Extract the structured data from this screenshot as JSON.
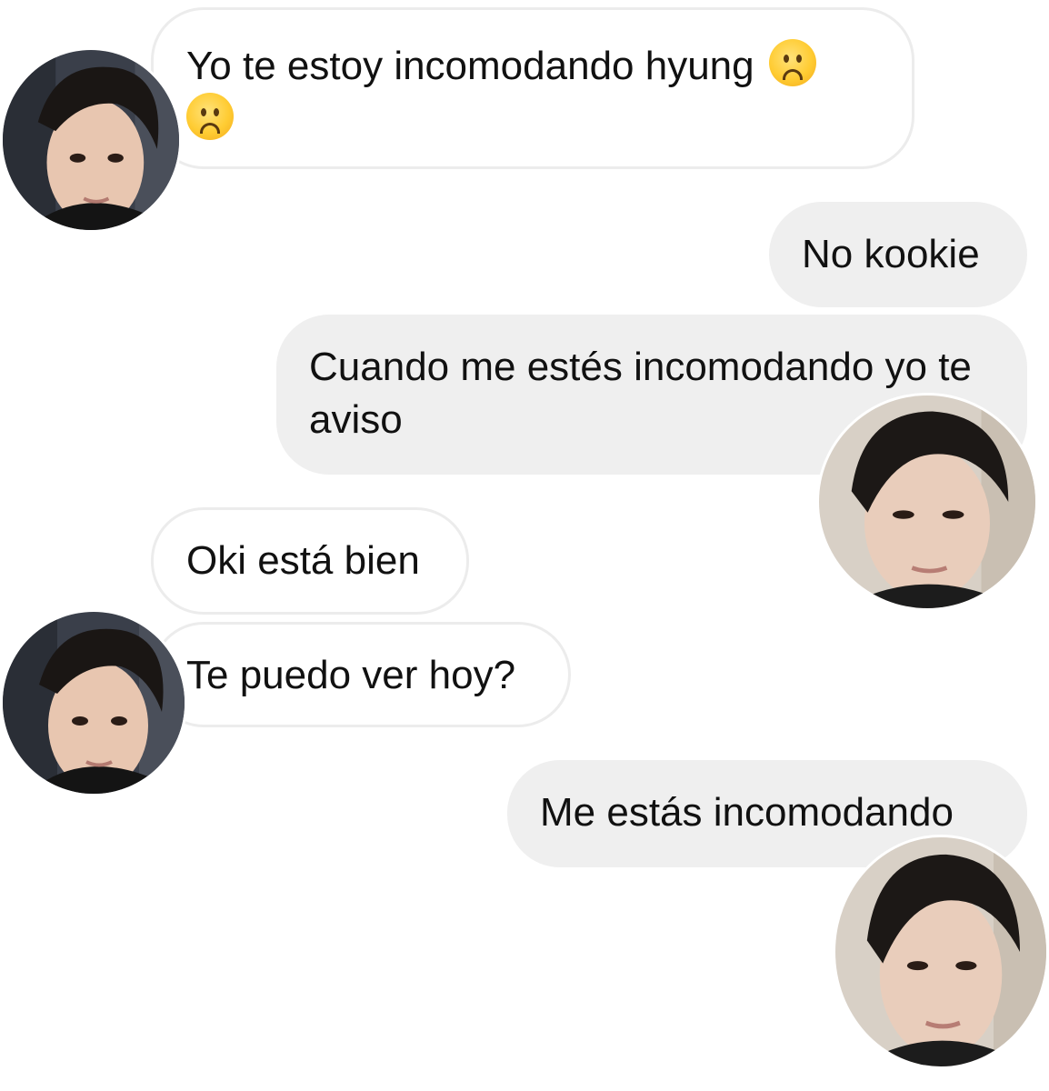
{
  "messages": [
    {
      "sender": "other",
      "text": "Yo te estoy incomodando hyung",
      "emojis": [
        "frowning-face",
        "frowning-face"
      ]
    },
    {
      "sender": "self",
      "text": "No kookie"
    },
    {
      "sender": "self",
      "text": "Cuando me estés incomodando yo te aviso"
    },
    {
      "sender": "other",
      "text": "Oki está bien"
    },
    {
      "sender": "other",
      "text": "Te puedo ver hoy?"
    },
    {
      "sender": "self",
      "text": "Me estás incomodando"
    }
  ],
  "avatars": {
    "other": "contact-avatar",
    "self": "user-avatar"
  },
  "colors": {
    "incoming_bubble": "#ffffff",
    "incoming_border": "#ececec",
    "outgoing_bubble": "#efefef",
    "text": "#111111"
  }
}
